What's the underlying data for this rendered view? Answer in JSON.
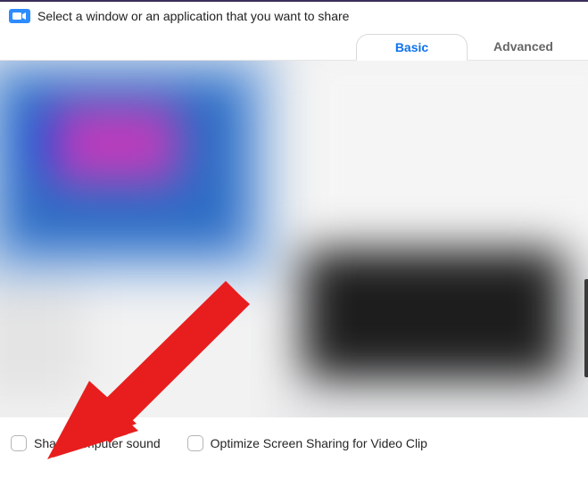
{
  "header": {
    "title": "Select a window or an application that you want to share"
  },
  "tabs": {
    "basic": "Basic",
    "advanced": "Advanced"
  },
  "footer": {
    "share_sound_label": "Share computer sound",
    "optimize_label": "Optimize Screen Sharing for Video Clip"
  }
}
